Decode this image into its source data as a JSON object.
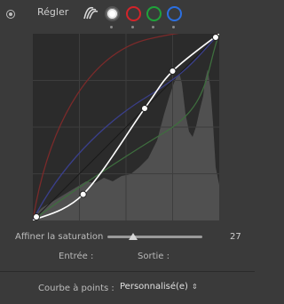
{
  "header": {
    "label": "Régler",
    "channels": [
      {
        "id": "luminance",
        "icon": "luminance-curve-icon",
        "selected": false
      },
      {
        "id": "rgb",
        "icon": "white-circle-icon",
        "selected": true
      },
      {
        "id": "red",
        "icon": "red-circle-icon",
        "color": "#d2242a",
        "selected": false
      },
      {
        "id": "green",
        "icon": "green-circle-icon",
        "color": "#1fa33a",
        "selected": false
      },
      {
        "id": "blue",
        "icon": "blue-circle-icon",
        "color": "#2c6fe0",
        "selected": false
      }
    ]
  },
  "curve": {
    "colors": {
      "background": "#2b2b2b",
      "histogram": "#505050",
      "grid": "#3d3d3d",
      "main": "#ffffff",
      "red": "#7a2a2a",
      "green": "#3e6e3e",
      "blue": "#3a3f8a"
    },
    "control_points": [
      {
        "input": 0,
        "output": 0
      },
      {
        "input": 27,
        "output": 14
      },
      {
        "input": 60,
        "output": 60
      },
      {
        "input": 75,
        "output": 80
      },
      {
        "input": 100,
        "output": 100
      }
    ]
  },
  "saturation": {
    "label": "Affiner la saturation",
    "value": "27",
    "level": 0.27
  },
  "readout": {
    "input_label": "Entrée :",
    "output_label": "Sortie :"
  },
  "footer": {
    "label": "Courbe à points :",
    "preset": "Personnalisé(e)"
  }
}
